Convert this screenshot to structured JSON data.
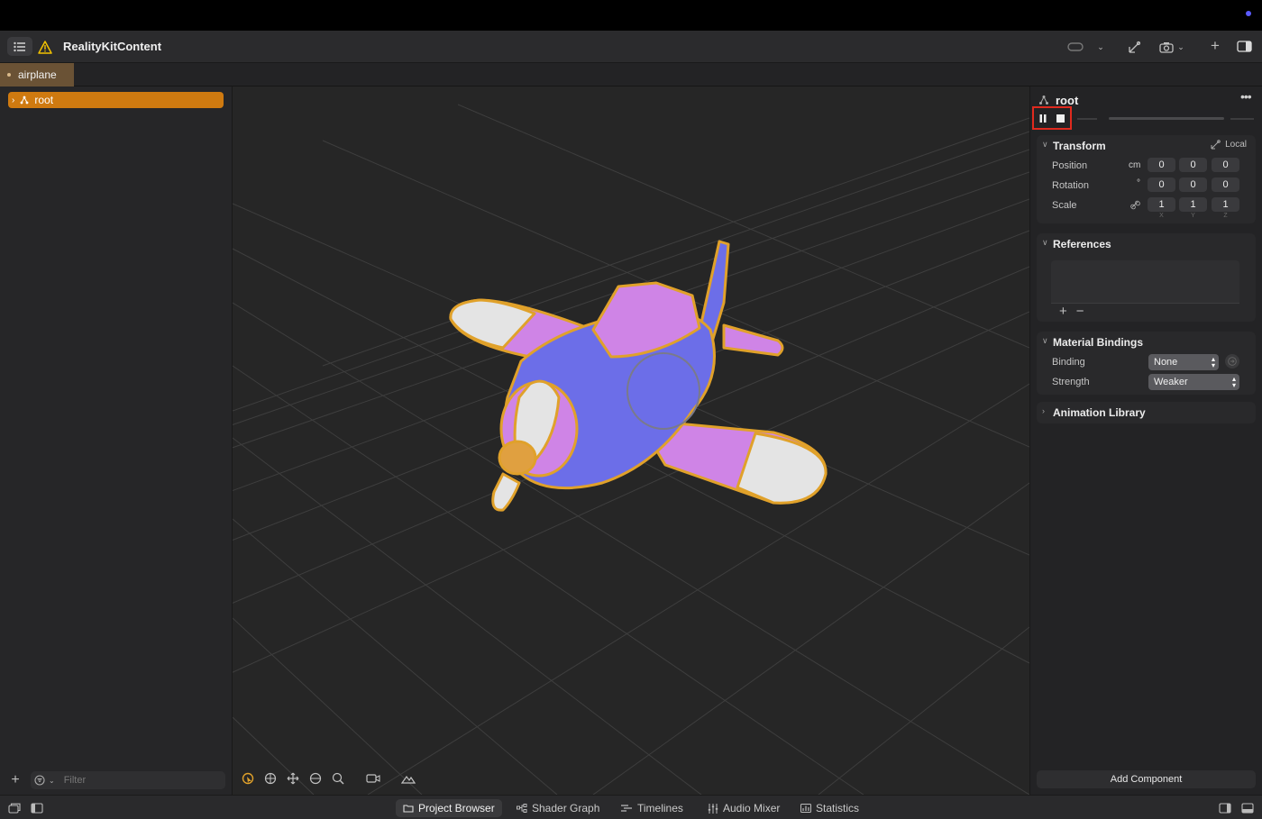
{
  "app": {
    "title": "RealityKitContent"
  },
  "tabs": [
    {
      "label": "airplane"
    }
  ],
  "hierarchy": {
    "root_label": "root"
  },
  "left_footer": {
    "filter_placeholder": "Filter"
  },
  "inspector": {
    "entity_name": "root",
    "transform": {
      "title": "Transform",
      "space_label": "Local",
      "position": {
        "label": "Position",
        "unit": "cm",
        "x": "0",
        "y": "0",
        "z": "0"
      },
      "rotation": {
        "label": "Rotation",
        "unit": "°",
        "x": "0",
        "y": "0",
        "z": "0"
      },
      "scale": {
        "label": "Scale",
        "x": "1",
        "y": "1",
        "z": "1"
      },
      "axes": [
        "X",
        "Y",
        "Z"
      ]
    },
    "references": {
      "title": "References"
    },
    "material_bindings": {
      "title": "Material Bindings",
      "binding_label": "Binding",
      "binding_value": "None",
      "strength_label": "Strength",
      "strength_value": "Weaker"
    },
    "animation_library": {
      "title": "Animation Library"
    },
    "add_component": "Add Component"
  },
  "bottom_tabs": [
    {
      "label": "Project Browser",
      "icon": "folder-icon"
    },
    {
      "label": "Shader Graph",
      "icon": "shader-graph-icon"
    },
    {
      "label": "Timelines",
      "icon": "timelines-icon"
    },
    {
      "label": "Audio Mixer",
      "icon": "audio-mixer-icon"
    },
    {
      "label": "Statistics",
      "icon": "statistics-icon"
    }
  ],
  "colors": {
    "selection": "#cf7a10",
    "highlight_box": "#e02a1e",
    "plane_body": "#6c6ee8",
    "plane_wing": "#cf84e6",
    "outline": "#e0a12a"
  }
}
